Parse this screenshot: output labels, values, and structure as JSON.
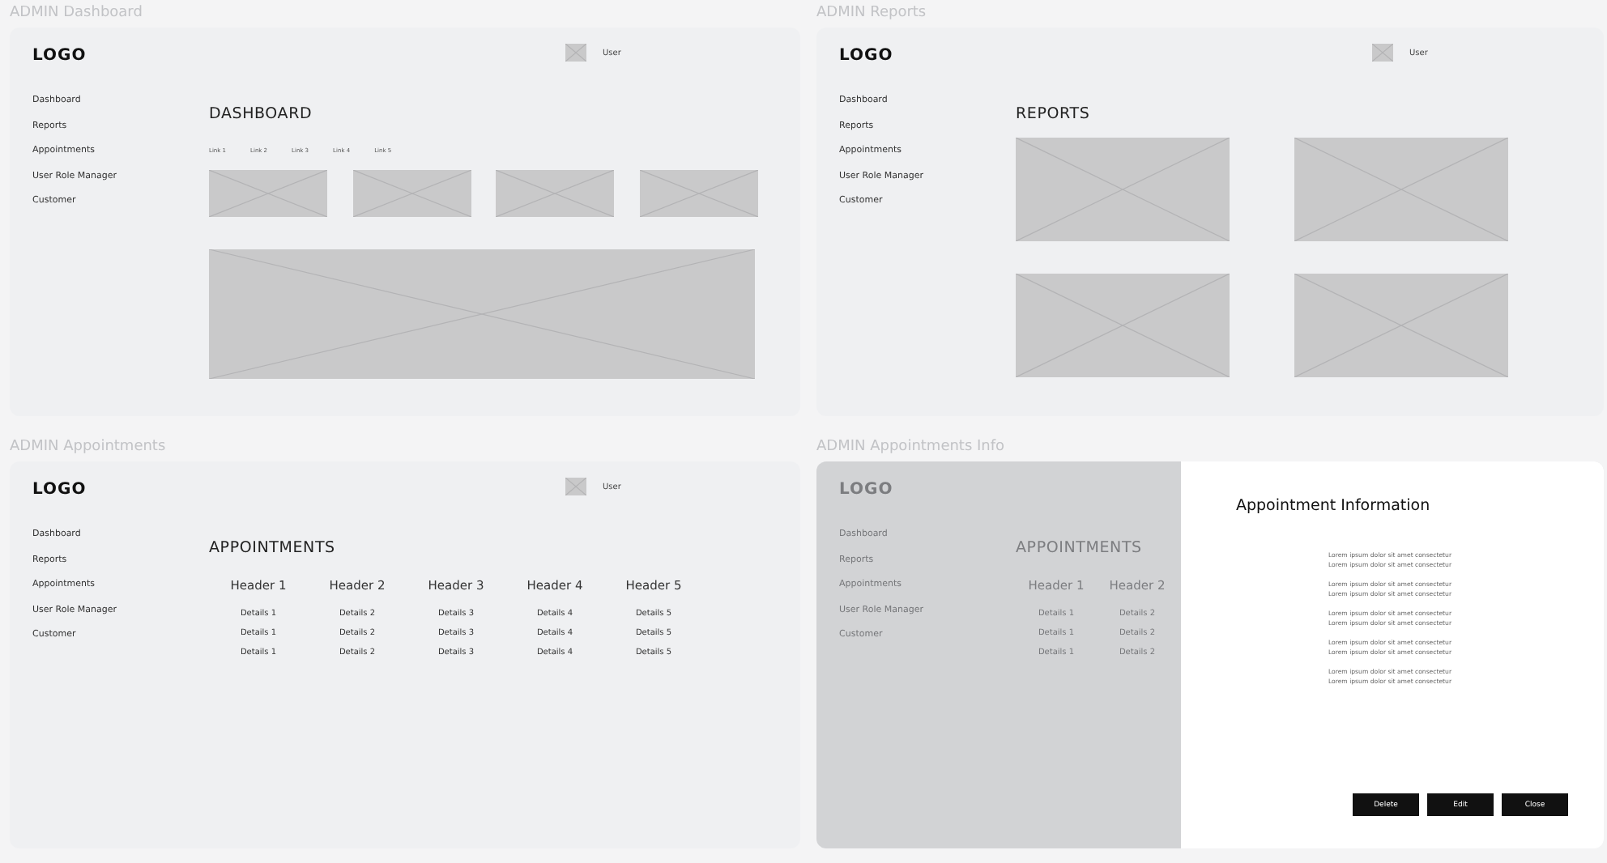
{
  "frames": [
    {
      "kind": "dashboard",
      "label": "ADMIN Dashboard",
      "logo": "LOGO",
      "user": "User",
      "nav": [
        "Dashboard",
        "Reports",
        "Appointments",
        "User Role Manager",
        "Customer"
      ],
      "title": "DASHBOARD",
      "links": [
        "Link 1",
        "Link 2",
        "Link 3",
        "Link 4",
        "Link 5"
      ]
    },
    {
      "kind": "reports",
      "label": "ADMIN Reports",
      "logo": "LOGO",
      "user": "User",
      "nav": [
        "Dashboard",
        "Reports",
        "Appointments",
        "User Role Manager",
        "Customer"
      ],
      "title": "REPORTS"
    },
    {
      "kind": "appointments",
      "label": "ADMIN Appointments",
      "logo": "LOGO",
      "user": "User",
      "nav": [
        "Dashboard",
        "Reports",
        "Appointments",
        "User Role Manager",
        "Customer"
      ],
      "title": "APPOINTMENTS",
      "table": {
        "columns": [
          "Header 1",
          "Header 2",
          "Header 3",
          "Header 4",
          "Header 5"
        ],
        "rows": [
          [
            "Details 1",
            "Details 2",
            "Details 3",
            "Details 4",
            "Details 5"
          ],
          [
            "Details 1",
            "Details 2",
            "Details 3",
            "Details 4",
            "Details 5"
          ],
          [
            "Details 1",
            "Details 2",
            "Details 3",
            "Details 4",
            "Details 5"
          ]
        ]
      }
    },
    {
      "kind": "info",
      "label": "ADMIN Appointments Info",
      "logo": "LOGO",
      "nav": [
        "Dashboard",
        "Reports",
        "Appointments",
        "User Role Manager",
        "Customer"
      ],
      "title": "APPOINTMENTS",
      "table": {
        "columns": [
          "Header 1",
          "Header 2"
        ],
        "rows": [
          [
            "Details 1",
            "Details 2"
          ],
          [
            "Details 1",
            "Details 2"
          ],
          [
            "Details 1",
            "Details 2"
          ]
        ]
      },
      "dialog": {
        "title": "Appointment Information",
        "paragraphs": [
          [
            "Lorem ipsum dolor sit amet consectetur",
            "Lorem ipsum dolor sit amet consectetur"
          ],
          [
            "Lorem ipsum dolor sit amet consectetur",
            "Lorem ipsum dolor sit amet consectetur"
          ],
          [
            "Lorem ipsum dolor sit amet consectetur",
            "Lorem ipsum dolor sit amet consectetur"
          ],
          [
            "Lorem ipsum dolor sit amet consectetur",
            "Lorem ipsum dolor sit amet consectetur"
          ],
          [
            "Lorem ipsum dolor sit amet consectetur",
            "Lorem ipsum dolor sit amet consectetur"
          ]
        ],
        "buttons": [
          "Delete",
          "Edit",
          "Close"
        ]
      }
    }
  ]
}
